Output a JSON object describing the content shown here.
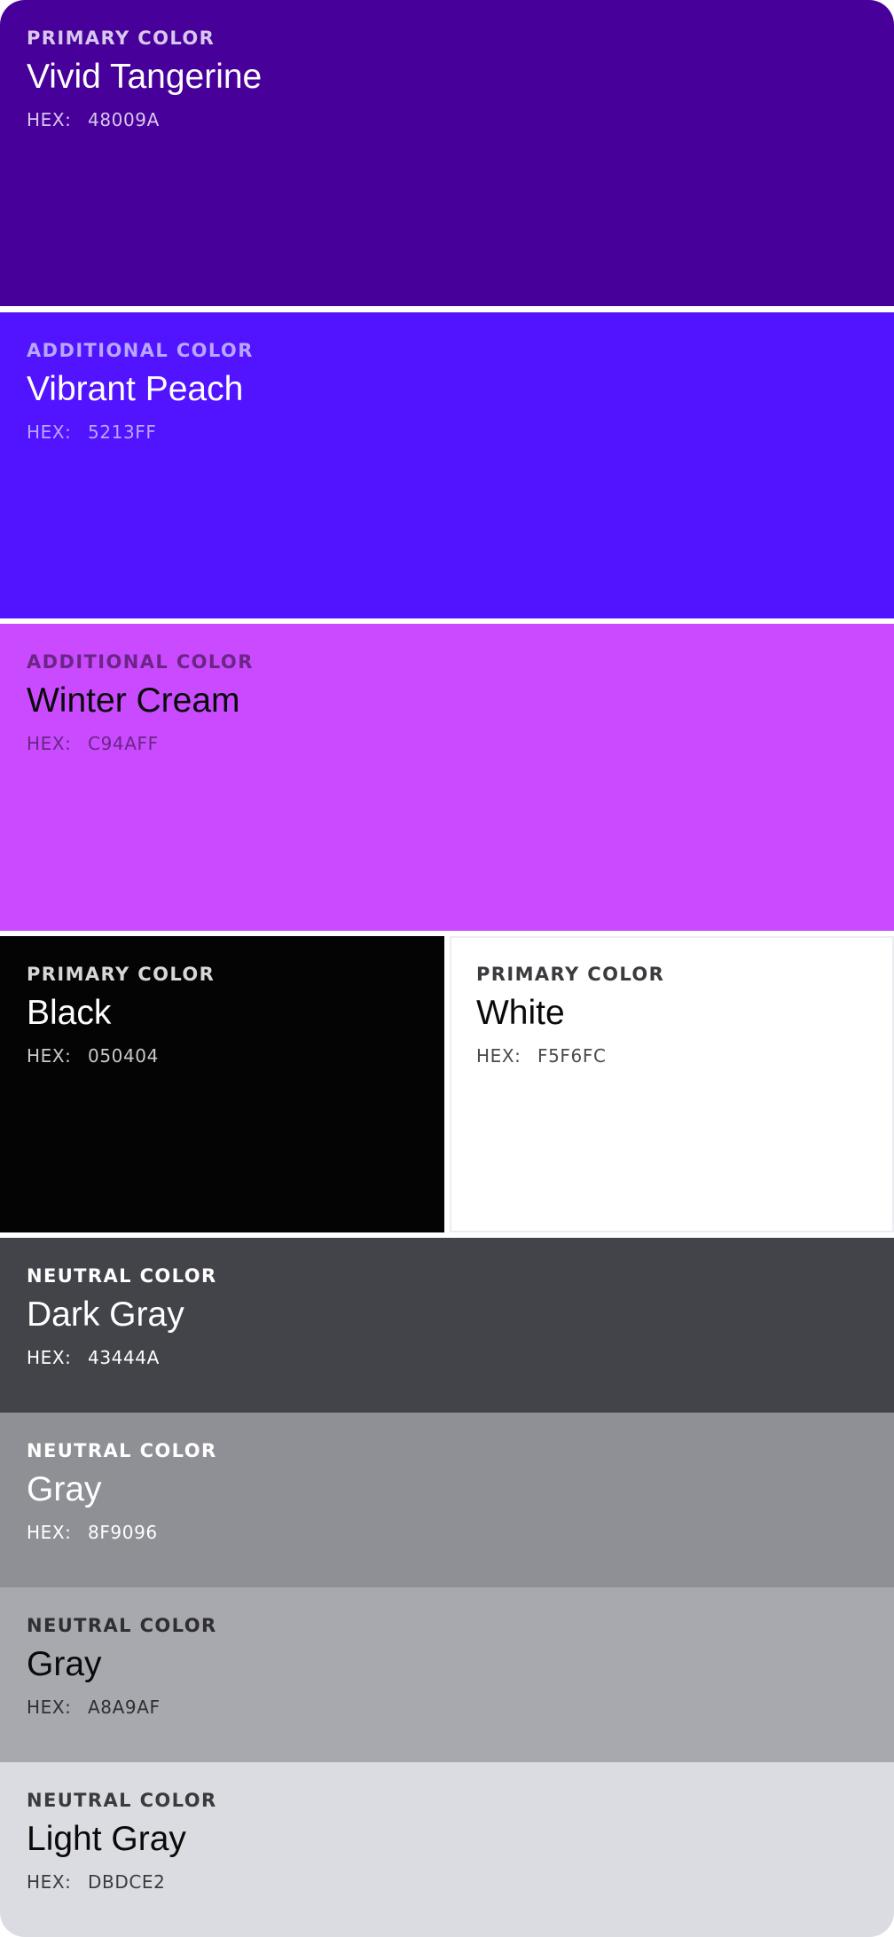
{
  "swatches": [
    {
      "category": "PRIMARY COLOR",
      "name": "Vivid Tangerine",
      "hex_label": "HEX:",
      "hex": "48009A",
      "color": "#48009A",
      "category_color": "#D8C7EE",
      "name_color": "#FFFFFF",
      "hex_color": "#D8C7EE"
    },
    {
      "category": "ADDITIONAL COLOR",
      "name": "Vibrant Peach",
      "hex_label": "HEX:",
      "hex": "5213FF",
      "color": "#5213FF",
      "category_color": "#B9A7FF",
      "name_color": "#FFFFFF",
      "hex_color": "#B9A7FF"
    },
    {
      "category": "ADDITIONAL COLOR",
      "name": "Winter Cream",
      "hex_label": "HEX:",
      "hex": "C94AFF",
      "color": "#C94AFF",
      "category_color": "#6B2585",
      "name_color": "#0A0A0A",
      "hex_color": "#6B2585"
    },
    {
      "category": "PRIMARY COLOR",
      "name": "Black",
      "hex_label": "HEX:",
      "hex": "050404",
      "color": "#050404",
      "category_color": "#D7D7D7",
      "name_color": "#FFFFFF",
      "hex_color": "#C9C9C9"
    },
    {
      "category": "PRIMARY COLOR",
      "name": "White",
      "hex_label": "HEX:",
      "hex": "F5F6FC",
      "color": "#FFFFFF",
      "category_color": "#3A3A3F",
      "name_color": "#0A0A0A",
      "hex_color": "#4A4A50"
    },
    {
      "category": "NEUTRAL COLOR",
      "name": "Dark Gray",
      "hex_label": "HEX:",
      "hex": "43444A",
      "color": "#43444A",
      "category_color": "#FFFFFF",
      "name_color": "#FFFFFF",
      "hex_color": "#FFFFFF"
    },
    {
      "category": "NEUTRAL COLOR",
      "name": "Gray",
      "hex_label": "HEX:",
      "hex": "8F9096",
      "color": "#8F9096",
      "category_color": "#FFFFFF",
      "name_color": "#FFFFFF",
      "hex_color": "#FFFFFF"
    },
    {
      "category": "NEUTRAL COLOR",
      "name": "Gray",
      "hex_label": "HEX:",
      "hex": "A8A9AF",
      "color": "#A8A9AF",
      "category_color": "#2E2E33",
      "name_color": "#0A0A0A",
      "hex_color": "#2E2E33"
    },
    {
      "category": "NEUTRAL COLOR",
      "name": "Light Gray",
      "hex_label": "HEX:",
      "hex": "DBDCE2",
      "color": "#DBDCE2",
      "category_color": "#3A3A3F",
      "name_color": "#0A0A0A",
      "hex_color": "#3A3A3F"
    }
  ]
}
